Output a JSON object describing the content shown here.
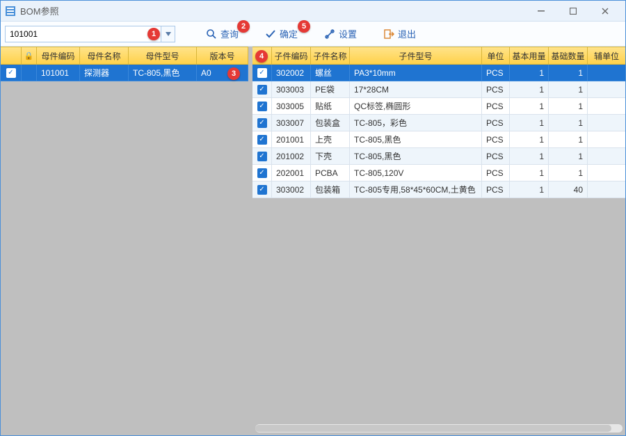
{
  "window": {
    "title": "BOM参照"
  },
  "toolbar": {
    "search_value": "101001",
    "query_label": "查询",
    "ok_label": "确定",
    "settings_label": "设置",
    "exit_label": "退出"
  },
  "left": {
    "headers": {
      "code": "母件编码",
      "name": "母件名称",
      "model": "母件型号",
      "version": "版本号"
    },
    "rows": [
      {
        "code": "101001",
        "name": "探测器",
        "model": "TC-805,黑色",
        "version": "A0",
        "selected": true
      }
    ],
    "widths": {
      "chk": 30,
      "code": 62,
      "name": 80,
      "model": 98,
      "version": 56
    }
  },
  "right": {
    "headers": {
      "code": "子件编码",
      "name": "子件名称",
      "model": "子件型号",
      "unit": "单位",
      "base_use": "基本用量",
      "base_qty": "基础数量",
      "aux_unit": "辅单位"
    },
    "rows": [
      {
        "code": "302002",
        "name": "螺丝",
        "model": "PA3*10mm",
        "unit": "PCS",
        "base_use": "1",
        "base_qty": "1",
        "selected": true
      },
      {
        "code": "303003",
        "name": "PE袋",
        "model": "17*28CM",
        "unit": "PCS",
        "base_use": "1",
        "base_qty": "1"
      },
      {
        "code": "303005",
        "name": "贴纸",
        "model": "QC标签,椭圆形",
        "unit": "PCS",
        "base_use": "1",
        "base_qty": "1"
      },
      {
        "code": "303007",
        "name": "包装盒",
        "model": "TC-805，彩色",
        "unit": "PCS",
        "base_use": "1",
        "base_qty": "1"
      },
      {
        "code": "201001",
        "name": "上壳",
        "model": "TC-805,黑色",
        "unit": "PCS",
        "base_use": "1",
        "base_qty": "1"
      },
      {
        "code": "201002",
        "name": "下壳",
        "model": "TC-805,黑色",
        "unit": "PCS",
        "base_use": "1",
        "base_qty": "1"
      },
      {
        "code": "202001",
        "name": "PCBA",
        "model": "TC-805,120V",
        "unit": "PCS",
        "base_use": "1",
        "base_qty": "1"
      },
      {
        "code": "303002",
        "name": "包装箱",
        "model": "TC-805专用,58*45*60CM,土黄色",
        "unit": "PCS",
        "base_use": "1",
        "base_qty": "40"
      }
    ],
    "widths": {
      "chk": 28,
      "code": 56,
      "name": 56,
      "model": 190,
      "unit": 40,
      "base_use": 56,
      "base_qty": 56,
      "aux_unit": 44
    }
  },
  "badges": {
    "b1": "1",
    "b2": "2",
    "b3": "3",
    "b4": "4",
    "b5": "5"
  }
}
